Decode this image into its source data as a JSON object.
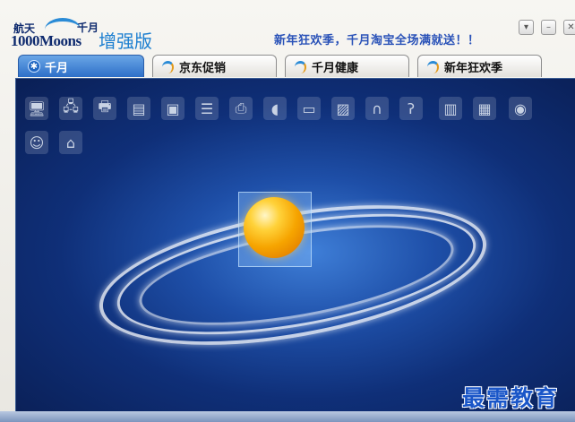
{
  "header": {
    "logo_top": "航天",
    "logo_brand": "1000Moons",
    "logo_sub": "千月",
    "edition": "增强版",
    "promo": "新年狂欢季，千月淘宝全场满就送！！",
    "window_buttons": [
      "menu-icon",
      "minimize-icon",
      "close-icon"
    ]
  },
  "tabs": [
    {
      "label": "千月",
      "icon": "bluetooth-icon",
      "active": true
    },
    {
      "label": "京东促销",
      "icon": "swirl-icon",
      "active": false
    },
    {
      "label": "千月健康",
      "icon": "swirl-icon",
      "active": false
    },
    {
      "label": "新年狂欢季",
      "icon": "swirl-icon",
      "active": false
    }
  ],
  "toolbar_icons": [
    "network-computer-icon",
    "network-share-icon",
    "printer-icon",
    "folder-icon",
    "device-icon",
    "document-icon",
    "fax-icon",
    "mouse-icon",
    "scanner-icon",
    "photo-icon",
    "headphones-icon",
    "headset-icon",
    "file-icon",
    "file-share-icon",
    "disc-icon",
    "user-icon",
    "network-printer-icon"
  ],
  "watermark": "最需教育",
  "colors": {
    "accent": "#2d6fc8",
    "panel_bg": "#0f2f78",
    "promo_text": "#2a52b8"
  }
}
